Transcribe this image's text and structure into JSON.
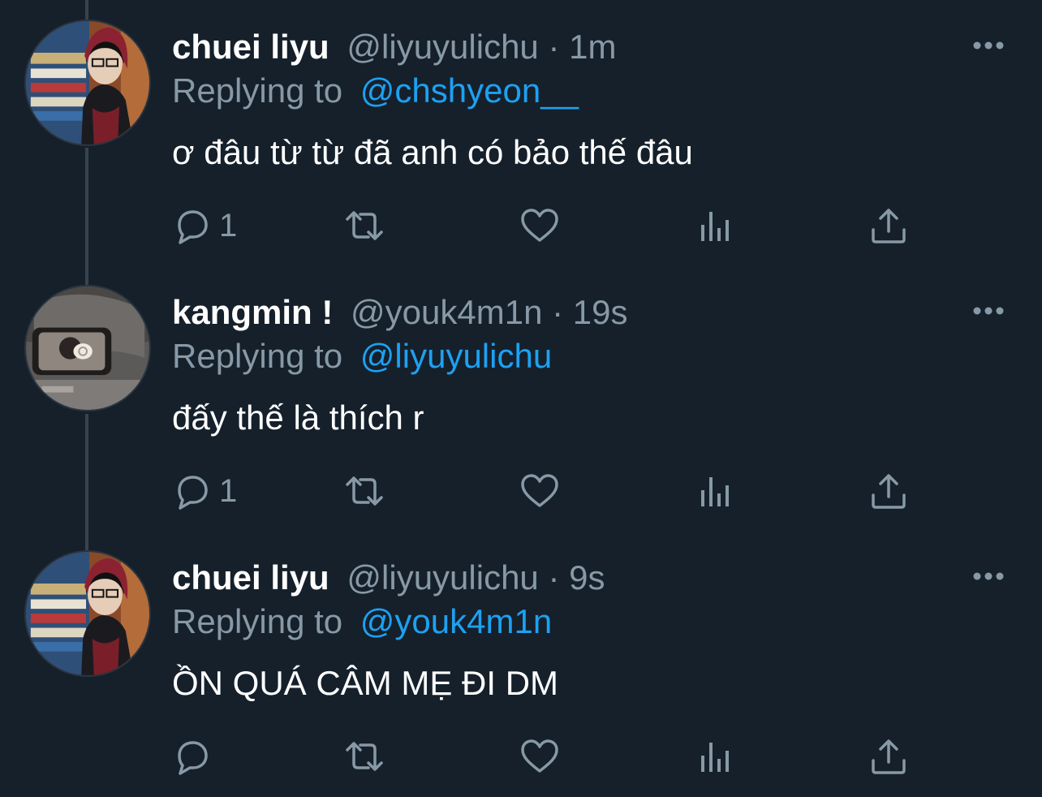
{
  "tweets": [
    {
      "display_name": "chuei liyu",
      "handle": "@liyuyulichu",
      "separator": "·",
      "time": "1m",
      "replying_prefix": "Replying to",
      "replying_to": "@chshyeon__",
      "text": "ơ đâu từ từ đã anh có bảo thế đâu",
      "reply_count": "1",
      "avatar": "chuei-liyu-avatar"
    },
    {
      "display_name": "kangmin !",
      "handle": "@youk4m1n",
      "separator": "·",
      "time": "19s",
      "replying_prefix": "Replying to",
      "replying_to": "@liyuyulichu",
      "text": "đấy thế là thích r",
      "reply_count": "1",
      "avatar": "kangmin-avatar"
    },
    {
      "display_name": "chuei liyu",
      "handle": "@liyuyulichu",
      "separator": "·",
      "time": "9s",
      "replying_prefix": "Replying to",
      "replying_to": "@youk4m1n",
      "text": "ỒN QUÁ CÂM MẸ ĐI DM",
      "reply_count": "",
      "avatar": "chuei-liyu-avatar"
    }
  ],
  "icons": {
    "reply": "reply-icon",
    "retweet": "retweet-icon",
    "like": "heart-icon",
    "stats": "analytics-icon",
    "share": "share-icon",
    "more": "more-icon"
  },
  "colors": {
    "background": "#15202b",
    "text": "#ffffff",
    "secondary": "#8899a6",
    "link": "#1da1f2",
    "thread_line": "#38444d"
  }
}
